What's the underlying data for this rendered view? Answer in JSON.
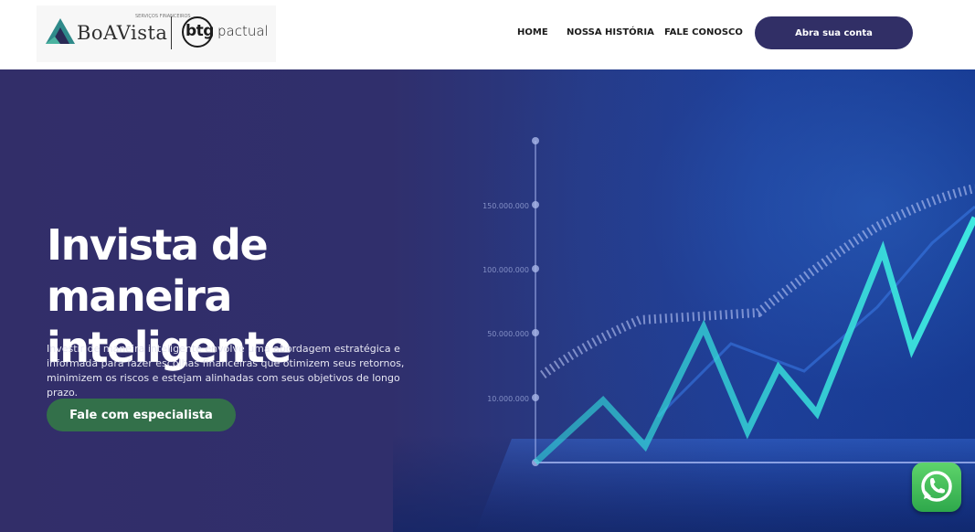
{
  "header": {
    "logo_boavista": "BoAVista",
    "logo_boavista_small": "SERVIÇOS FINANCEIROS",
    "logo_btg": "btg",
    "logo_pactual": "pactual",
    "nav": [
      {
        "label": "HOME"
      },
      {
        "label": "NOSSA HISTÓRIA"
      },
      {
        "label": "FALE CONOSCO"
      }
    ],
    "cta_label": "Abra sua conta"
  },
  "hero": {
    "title_line1": "Invista de maneira",
    "title_line2": "inteligente",
    "description": "Investir de maneira inteligente envolve uma abordagem estratégica e informada para fazer escolhas financeiras que otimizem seus retornos, minimizem os riscos e estejam alinhadas com seus objetivos de longo prazo.",
    "cta_label": "Fale com especialista"
  },
  "background_chart": {
    "axis_labels": [
      "150.000.000",
      "100.000.000",
      "50.000.000",
      "10.000.000"
    ]
  },
  "colors": {
    "nav_cta": "#312f66",
    "hero_cta": "#33704a",
    "hero_bg": "#302f6c",
    "chart_line": "#2fd3d6",
    "whatsapp": "#3fbf58"
  },
  "floating": {
    "whatsapp_icon": "whatsapp-icon"
  }
}
